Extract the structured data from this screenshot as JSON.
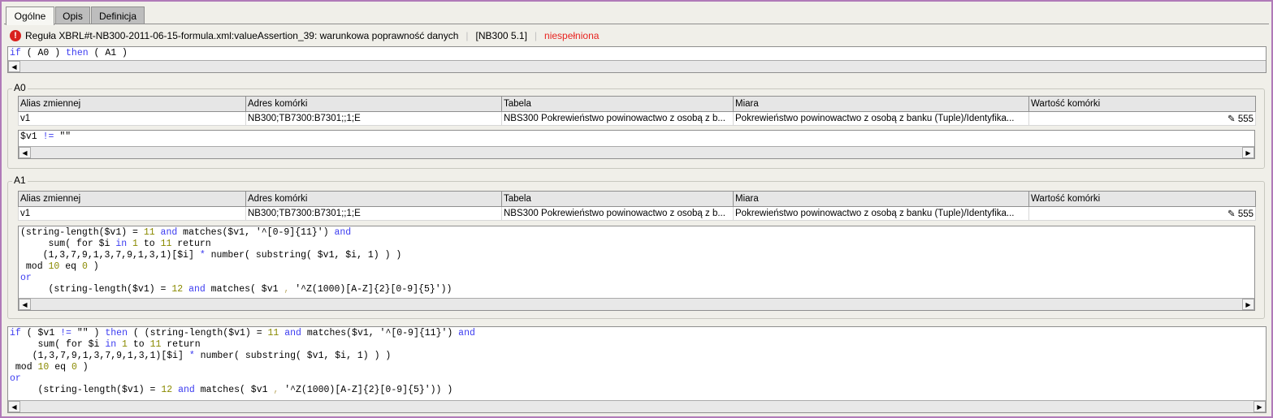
{
  "tabs": [
    {
      "label": "Ogólne",
      "active": true
    },
    {
      "label": "Opis"
    },
    {
      "label": "Definicja"
    }
  ],
  "header": {
    "icon": "error-icon",
    "rule": "Reguła XBRL#t-NB300-2011-06-15-formula.xml:valueAssertion_39: warunkowa poprawność danych",
    "code": "[NB300 5.1]",
    "status": "niespełniona",
    "status_color": "#e8231f"
  },
  "top_expression": [
    [
      [
        "if",
        "kw"
      ],
      [
        " ( A0 ) ",
        ""
      ],
      [
        "then",
        "kw"
      ],
      [
        " ( A1 )",
        ""
      ]
    ]
  ],
  "columns": [
    "Alias zmiennej",
    "Adres komórki",
    "Tabela",
    "Miara",
    "Wartość komórki"
  ],
  "groups": [
    {
      "title": "A0",
      "rows": [
        [
          "v1",
          "NB300;TB7300:B7301;;1;E",
          "NBS300 Pokrewieństwo powinowactwo z osobą z b...",
          "Pokrewieństwo powinowactwo z osobą z banku (Tuple)/Identyfika...",
          "555"
        ]
      ],
      "expression": [
        [
          [
            "$v1 ",
            ""
          ],
          [
            "!=",
            "kw"
          ],
          [
            " \"\"",
            ""
          ]
        ]
      ]
    },
    {
      "title": "A1",
      "rows": [
        [
          "v1",
          "NB300;TB7300:B7301;;1;E",
          "NBS300 Pokrewieństwo powinowactwo z osobą z b...",
          "Pokrewieństwo powinowactwo z osobą z banku (Tuple)/Identyfika...",
          "555"
        ]
      ],
      "expression": [
        [
          [
            "(string-length($v1) = ",
            ""
          ],
          [
            "11",
            "num"
          ],
          [
            " ",
            ""
          ],
          [
            "and",
            "kw"
          ],
          [
            " matches($v1, '^[0-9]{11}') ",
            ""
          ],
          [
            "and",
            "kw"
          ]
        ],
        [
          [
            "     sum( for $i ",
            ""
          ],
          [
            "in",
            "kw"
          ],
          [
            " ",
            ""
          ],
          [
            "1",
            "num"
          ],
          [
            " to ",
            ""
          ],
          [
            "11",
            "num"
          ],
          [
            " return",
            ""
          ]
        ],
        [
          [
            "    (1,3,7,9,1,3,7,9,1,3,1)[$i] ",
            ""
          ],
          [
            "*",
            "kw"
          ],
          [
            " number( substring( $v1, $i, 1) ) )",
            ""
          ]
        ],
        [
          [
            " mod ",
            ""
          ],
          [
            "10",
            "num"
          ],
          [
            " eq ",
            ""
          ],
          [
            "0",
            "num"
          ],
          [
            " )",
            ""
          ]
        ],
        [
          [
            "or",
            "kw"
          ]
        ],
        [
          [
            "     (string-length($v1) = ",
            ""
          ],
          [
            "12",
            "num"
          ],
          [
            " ",
            ""
          ],
          [
            "and",
            "kw"
          ],
          [
            " matches( $v1 ",
            ""
          ],
          [
            ",",
            "pu"
          ],
          [
            " '^Z(1000)[A-Z]{2}[0-9]{5}'))",
            ""
          ]
        ]
      ]
    }
  ],
  "full_expression": [
    [
      [
        "if",
        "kw"
      ],
      [
        " ( $v1 ",
        ""
      ],
      [
        "!=",
        "kw"
      ],
      [
        " \"\" ) ",
        ""
      ],
      [
        "then",
        "kw"
      ],
      [
        " ( (string-length($v1) = ",
        ""
      ],
      [
        "11",
        "num"
      ],
      [
        " ",
        ""
      ],
      [
        "and",
        "kw"
      ],
      [
        " matches($v1, '^[0-9]{11}') ",
        ""
      ],
      [
        "and",
        "kw"
      ]
    ],
    [
      [
        "     sum( for $i ",
        ""
      ],
      [
        "in",
        "kw"
      ],
      [
        " ",
        ""
      ],
      [
        "1",
        "num"
      ],
      [
        " to ",
        ""
      ],
      [
        "11",
        "num"
      ],
      [
        " return",
        ""
      ]
    ],
    [
      [
        "    (1,3,7,9,1,3,7,9,1,3,1)[$i] ",
        ""
      ],
      [
        "*",
        "kw"
      ],
      [
        " number( substring( $v1, $i, 1) ) )",
        ""
      ]
    ],
    [
      [
        " mod ",
        ""
      ],
      [
        "10",
        "num"
      ],
      [
        " eq ",
        ""
      ],
      [
        "0",
        "num"
      ],
      [
        " )",
        ""
      ]
    ],
    [
      [
        "or",
        "kw"
      ]
    ],
    [
      [
        "     (string-length($v1) = ",
        ""
      ],
      [
        "12",
        "num"
      ],
      [
        " ",
        ""
      ],
      [
        "and",
        "kw"
      ],
      [
        " matches( $v1 ",
        ""
      ],
      [
        ",",
        "pu"
      ],
      [
        " '^Z(1000)[A-Z]{2}[0-9]{5}')) )",
        ""
      ]
    ]
  ]
}
